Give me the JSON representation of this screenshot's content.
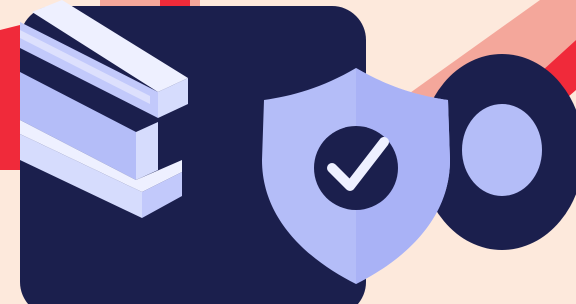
{
  "illustration": {
    "icons": {
      "shield": "shield-check-icon",
      "steel_beam": "steel-beam-icon",
      "washer": "washer-disc-icon"
    }
  },
  "colors": {
    "background": "#fde9dc",
    "navy": "#1b1f4d",
    "periwinkle": "#b4bdf8",
    "beam_light": "#eef0ff",
    "beam_mid": "#d6dcfd",
    "beam_shade": "#c2c9fb",
    "red": "#f02a3a",
    "salmon": "#f4a79b"
  }
}
